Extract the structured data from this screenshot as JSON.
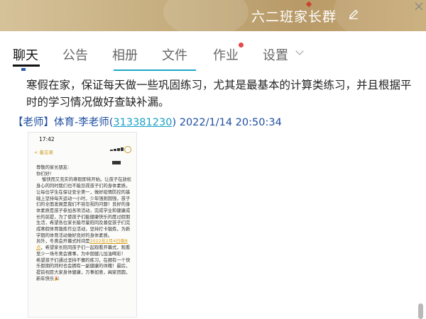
{
  "header": {
    "title": "六二班家长群"
  },
  "tabs": [
    {
      "label": "聊天",
      "active": true
    },
    {
      "label": "公告"
    },
    {
      "label": "相册"
    },
    {
      "label": "文件"
    },
    {
      "label": "作业",
      "badge": true
    },
    {
      "label": "设置",
      "dropdown": true
    }
  ],
  "chat": {
    "message_text": "寒假在家，保证每天做一些巩固练习，尤其是最基本的计算类练习，并且根据平时的学习情况做好查缺补漏。",
    "sender": {
      "role": "【老师】",
      "name": "体育-李老师",
      "qq_open": "(",
      "qq": "313381230",
      "qq_close": ")",
      "datetime": "2022/1/14 20:50:34"
    },
    "image": {
      "status_time": "17:42",
      "back_label": "< 备忘录",
      "body_pre": "尊敬的家长朋友:\n你们好!\n    愉快而又充实的寒假即将开始。让孩子在放松身心的同时我们也不能忽视孩子们的身体素质。让每位学生在保证安全第一，做好疫情防控的基础上坚持每天运动一小时，少年强则国强，孩子们的全面发展是我们不容忽视的问题！良好的身体素质是孩子参加各项活动，完成学业和健康成长的前提，为了使孩子们能健康快乐的度过假期生活，希望各位家长能尽量陪同及督促孩子们完成寒假体育锻炼作业活动，坚持打卡锻炼，为新学期的体育活动做好良好的身体素质。\n另外，冬奥会开幕式时间是",
      "body_highlight": "2022年2月4日晚8点",
      "body_post": "，希望家长陪同孩子们一起观看开幕式，观看至少一场冬奥会赛事，为中国健儿加油喝彩！\n希望孩子们通过坚持不懈的练习，在拥有一个快乐假期的同时也会拥有一副健康的体魄！最后，提前祝愿大家身体健康，万事如意，阖家团圆，新年快乐🎉"
    }
  },
  "colors": {
    "header_gold": "#c5ad7e",
    "sender_blue": "#1f4fa0",
    "link_cyan": "#17a1c4",
    "badge_red": "#e5484d"
  },
  "icons": [
    "edit-icon",
    "chevron-down-icon",
    "close-icon"
  ]
}
